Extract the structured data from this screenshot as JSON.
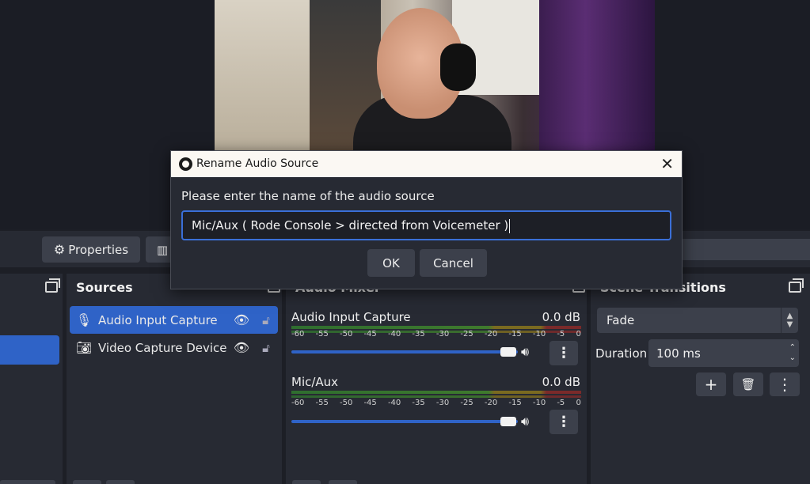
{
  "toolbar": {
    "properties_label": "Properties",
    "properties_icon": "gear-icon",
    "filters_icon": "filters-icon"
  },
  "docks": {
    "sources": {
      "title": "Sources"
    },
    "mixer": {
      "title": "Audio Mixer"
    },
    "transitions": {
      "title": "Scene Transitions"
    }
  },
  "sources": {
    "items": [
      {
        "label": "Audio Input Capture",
        "icon": "microphone-icon",
        "selected": true
      },
      {
        "label": "Video Capture Device",
        "icon": "camera-icon",
        "selected": false
      }
    ]
  },
  "mixer": {
    "tracks": [
      {
        "name": "Audio Input Capture",
        "db": "0.0 dB",
        "volume": 1.0
      },
      {
        "name": "Mic/Aux",
        "db": "0.0 dB",
        "volume": 1.0
      }
    ],
    "ticks": [
      "-60",
      "-55",
      "-50",
      "-45",
      "-40",
      "-35",
      "-30",
      "-25",
      "-20",
      "-15",
      "-10",
      "-5",
      "0"
    ]
  },
  "transitions": {
    "selected": "Fade",
    "duration_label": "Duration",
    "duration_value": "100 ms"
  },
  "dialog": {
    "title": "Rename Audio Source",
    "prompt": "Please enter the name of the audio source",
    "input_value": "Mic/Aux ( Rode Console > directed from Voicemeter )",
    "ok_label": "OK",
    "cancel_label": "Cancel"
  },
  "colors": {
    "accent": "#2f63c7",
    "background": "#1d1f26",
    "panel": "#272a33",
    "button": "#3c404b"
  }
}
